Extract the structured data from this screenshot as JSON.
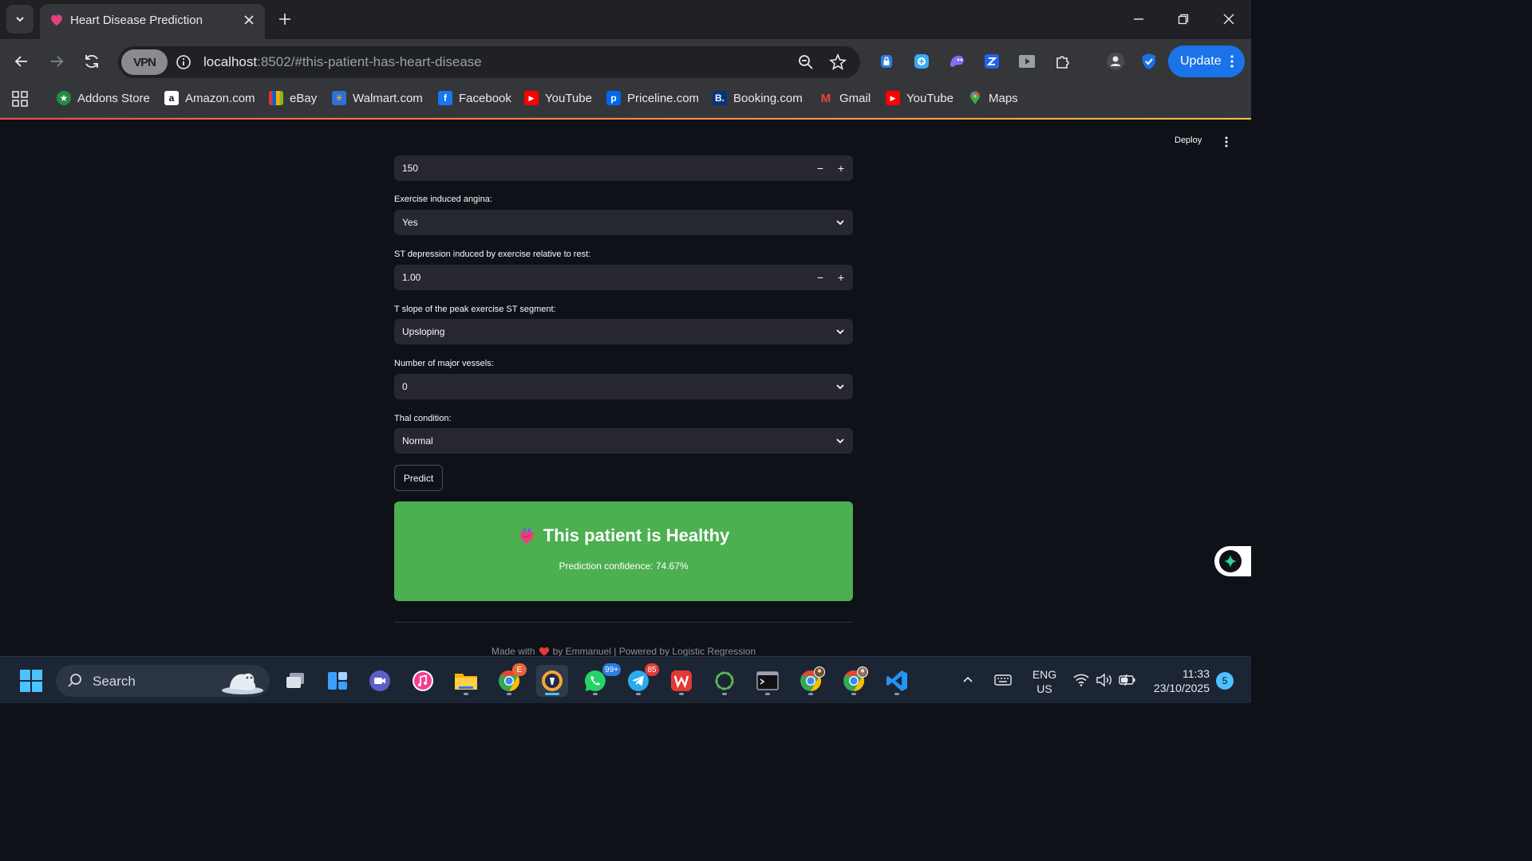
{
  "browser": {
    "tab_title": "Heart Disease Prediction",
    "vpn_label": "VPN",
    "url_host": "localhost",
    "url_rest": ":8502/#this-patient-has-heart-disease",
    "update_label": "Update",
    "bookmarks": [
      {
        "label": "Addons Store",
        "icon": "addons-store-icon",
        "color": "#1e8e3e"
      },
      {
        "label": "Amazon.com",
        "icon": "amazon-icon",
        "color": "#ffffff"
      },
      {
        "label": "eBay",
        "icon": "ebay-icon",
        "color": "#e53238"
      },
      {
        "label": "Walmart.com",
        "icon": "walmart-icon",
        "color": "#4a90e2"
      },
      {
        "label": "Facebook",
        "icon": "facebook-icon",
        "color": "#1877f2"
      },
      {
        "label": "YouTube",
        "icon": "youtube-icon",
        "color": "#ff0000"
      },
      {
        "label": "Priceline.com",
        "icon": "priceline-icon",
        "color": "#0068ef"
      },
      {
        "label": "Booking.com",
        "icon": "booking-icon",
        "color": "#003580"
      },
      {
        "label": "Gmail",
        "icon": "gmail-icon",
        "color": "#ea4335"
      },
      {
        "label": "YouTube",
        "icon": "youtube-icon",
        "color": "#ff0000"
      },
      {
        "label": "Maps",
        "icon": "maps-icon",
        "color": "#34a853"
      }
    ]
  },
  "app": {
    "deploy_label": "Deploy",
    "max_heart_rate_value": "150",
    "angina_label": "Exercise induced angina:",
    "angina_value": "Yes",
    "st_depression_label": "ST depression induced by exercise relative to rest:",
    "st_depression_value": "1.00",
    "slope_label": "T slope of the peak exercise ST segment:",
    "slope_value": "Upsloping",
    "vessels_label": "Number of major vessels:",
    "vessels_value": "0",
    "thal_label": "Thal condition:",
    "thal_value": "Normal",
    "stepper_minus": "−",
    "stepper_plus": "+",
    "predict_label": "Predict",
    "result_title": "This patient is Healthy",
    "result_confidence": "Prediction confidence: 74.67%",
    "result_color": "#4caf50",
    "footer_before": "Made with",
    "footer_after": "by Emmanuel | Powered by Logistic Regression"
  },
  "taskbar": {
    "search_label": "Search",
    "whatsapp_badge": "99+",
    "telegram_badge": "85",
    "lang_line1": "ENG",
    "lang_line2": "US",
    "time": "11:33",
    "date": "23/10/2025",
    "notification_count": "5"
  }
}
